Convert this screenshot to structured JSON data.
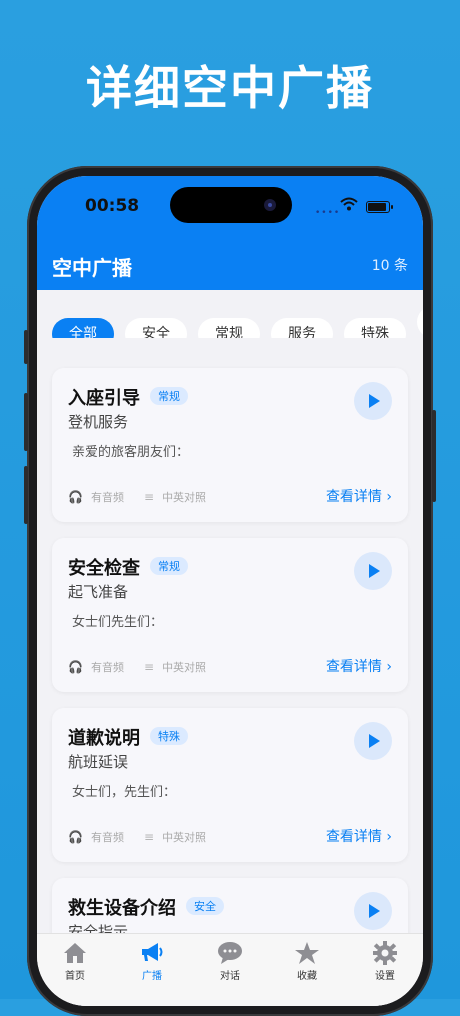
{
  "headline": "详细空中广播",
  "status": {
    "time": "00:58"
  },
  "appbar": {
    "title": "空中广播",
    "count": "10 条"
  },
  "filters": [
    "全部",
    "安全",
    "常规",
    "服务",
    "特殊",
    ""
  ],
  "cards": [
    {
      "title": "入座引导",
      "tag": "常规",
      "subtitle": "登机服务",
      "greeting": "亲爱的旅客朋友们：",
      "audio": "有音频",
      "bilingual": "中英对照",
      "detail": "查看详情"
    },
    {
      "title": "安全检查",
      "tag": "常规",
      "subtitle": "起飞准备",
      "greeting": "女士们先生们：",
      "audio": "有音频",
      "bilingual": "中英对照",
      "detail": "查看详情"
    },
    {
      "title": "道歉说明",
      "tag": "特殊",
      "subtitle": "航班延误",
      "greeting": "女士们，先生们：",
      "audio": "有音频",
      "bilingual": "中英对照",
      "detail": "查看详情"
    },
    {
      "title": "救生设备介绍",
      "tag": "安全",
      "subtitle": "安全指示",
      "greeting": "",
      "audio": "",
      "bilingual": "",
      "detail": ""
    }
  ],
  "tabs": [
    {
      "label": "首页",
      "icon": "home-icon"
    },
    {
      "label": "广播",
      "icon": "megaphone-icon"
    },
    {
      "label": "对话",
      "icon": "chat-bubble-icon"
    },
    {
      "label": "收藏",
      "icon": "star-icon"
    },
    {
      "label": "设置",
      "icon": "gear-icon"
    }
  ],
  "colors": {
    "accent": "#0a80f3",
    "background": "#2a9fe0"
  }
}
